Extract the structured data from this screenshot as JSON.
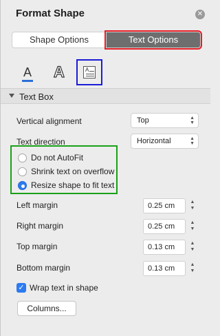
{
  "panel": {
    "title": "Format Shape",
    "close_icon": "close-icon"
  },
  "tabs": {
    "shape_options": "Shape Options",
    "text_options": "Text Options",
    "selected": "Text Options"
  },
  "subtabs": [
    {
      "icon": "text-fill-icon",
      "glyph": "A"
    },
    {
      "icon": "text-effects-icon",
      "glyph": "A"
    },
    {
      "icon": "textbox-icon",
      "glyph": "A",
      "selected": true
    }
  ],
  "section": {
    "title": "Text Box",
    "vertical_alignment": {
      "label": "Vertical alignment",
      "value": "Top"
    },
    "text_direction": {
      "label": "Text direction",
      "value": "Horizontal"
    },
    "autofit": {
      "options": [
        "Do not AutoFit",
        "Shrink text on overflow",
        "Resize shape to fit text"
      ],
      "selected": "Resize shape to fit text"
    },
    "left_margin": {
      "label": "Left margin",
      "value": "0.25 cm"
    },
    "right_margin": {
      "label": "Right margin",
      "value": "0.25 cm"
    },
    "top_margin": {
      "label": "Top margin",
      "value": "0.13 cm"
    },
    "bottom_margin": {
      "label": "Bottom margin",
      "value": "0.13 cm"
    },
    "wrap_text": {
      "label": "Wrap text in shape",
      "checked": true
    },
    "columns_button": "Columns..."
  },
  "colors": {
    "accent": "#2d7bf0",
    "selected_tab": "#6e6e6e",
    "highlight_red": "#e41e26",
    "highlight_blue": "#1a1ad8",
    "highlight_green": "#18a018"
  }
}
